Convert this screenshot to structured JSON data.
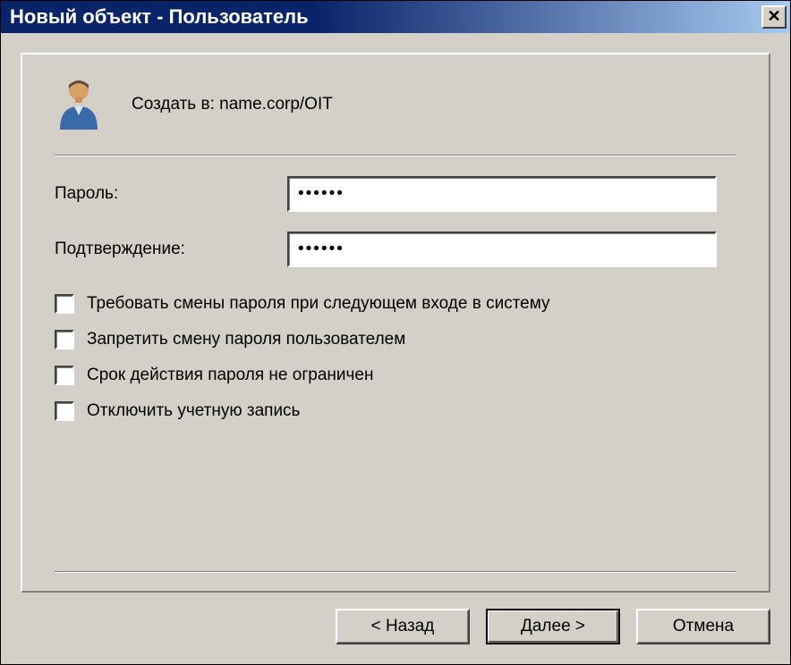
{
  "title": "Новый объект - Пользователь",
  "head": {
    "create_in_label": "Создать в:",
    "create_in_path": "name.corp/OIT"
  },
  "fields": {
    "password_label": "Пароль:",
    "password_value": "••••••",
    "confirm_label": "Подтверждение:",
    "confirm_value": "••••••"
  },
  "checkboxes": {
    "change_next_logon": "Требовать смены пароля при следующем входе в систему",
    "cannot_change": "Запретить смену пароля пользователем",
    "never_expires": "Срок действия пароля не ограничен",
    "disable_account": "Отключить учетную запись"
  },
  "buttons": {
    "back": "< Назад",
    "next": "Далее >",
    "cancel": "Отмена"
  }
}
